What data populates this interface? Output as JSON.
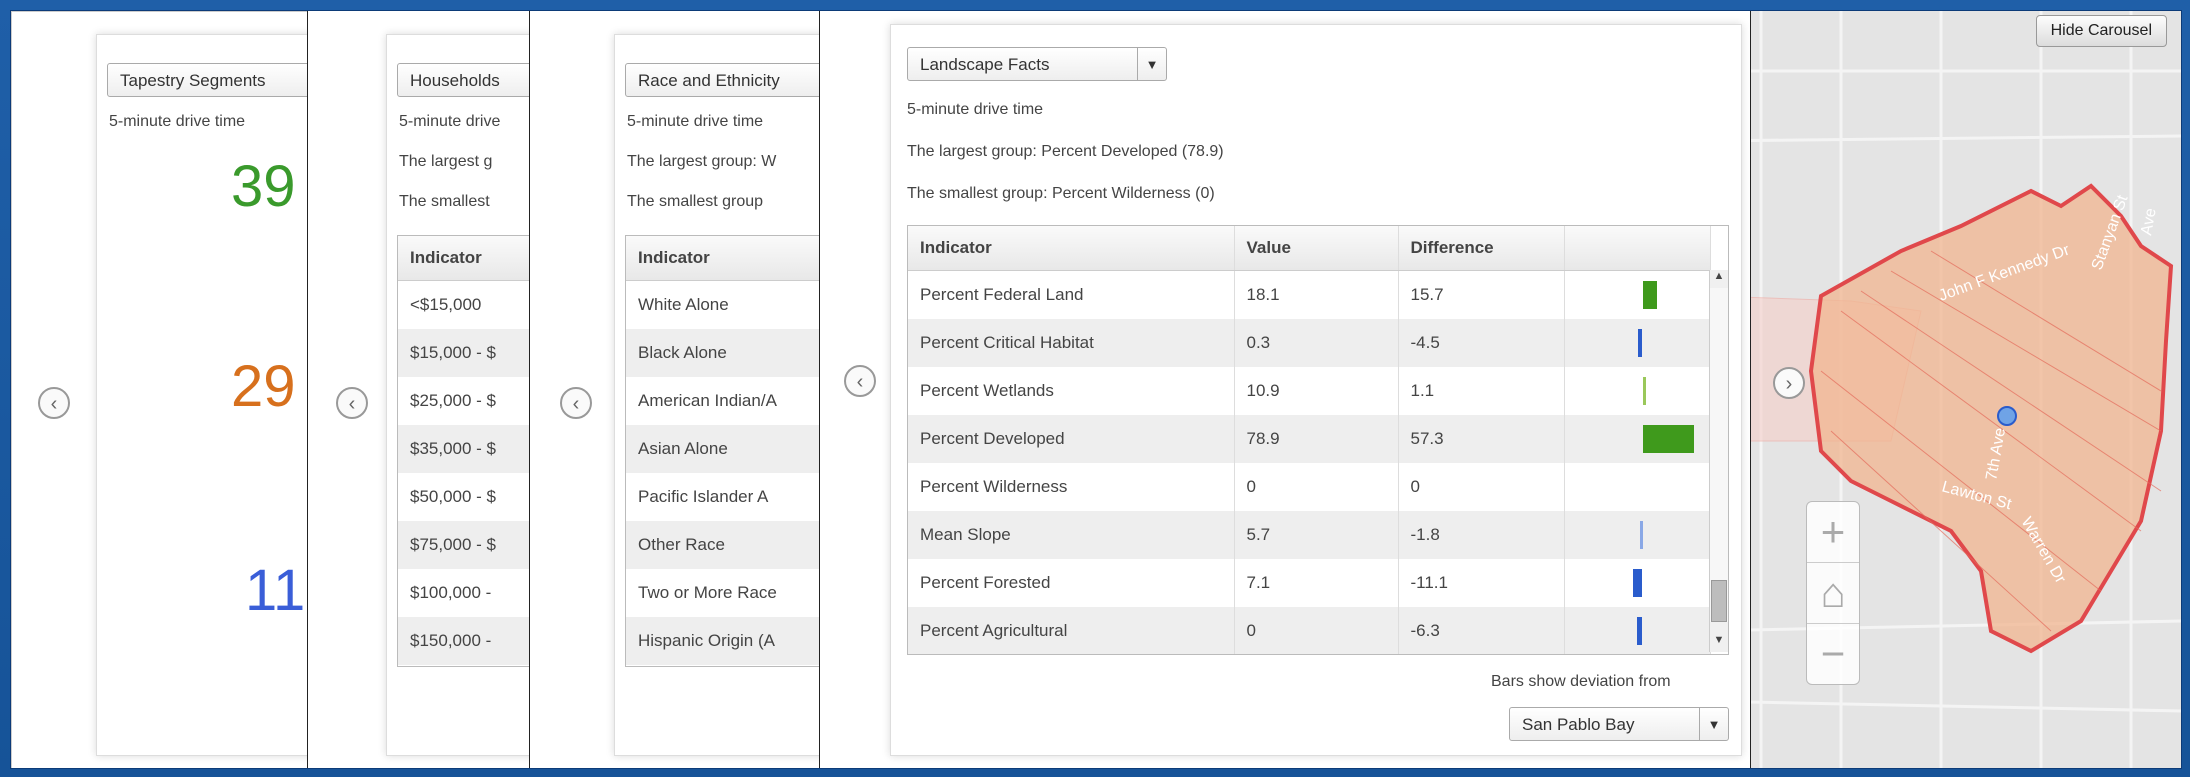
{
  "map": {
    "hide_carousel_label": "Hide Carousel",
    "street_labels": [
      "John F Kennedy Dr",
      "Stanyan St",
      "Lawton St",
      "7th Ave",
      "Warren Dr",
      "Ave"
    ]
  },
  "panel1": {
    "dropdown": "Tapestry Segments",
    "drive_time": "5-minute drive time",
    "numbers": [
      {
        "value": "39",
        "color": "#3a9a2c"
      },
      {
        "value": "29",
        "color": "#d7701d"
      },
      {
        "value": "11",
        "color": "#3a5ed8"
      }
    ]
  },
  "panel2": {
    "dropdown": "Households",
    "drive_time": "5-minute drive",
    "largest": "The largest g",
    "smallest": "The smallest",
    "header": "Indicator",
    "rows": [
      "<$15,000",
      "$15,000 - $",
      "$25,000 - $",
      "$35,000 - $",
      "$50,000 - $",
      "$75,000 - $",
      "$100,000 -",
      "$150,000 -"
    ]
  },
  "panel3": {
    "dropdown": "Race and Ethnicity",
    "drive_time": "5-minute drive time",
    "largest": "The largest group: W",
    "smallest": "The smallest group",
    "header": "Indicator",
    "rows": [
      "White Alone",
      "Black Alone",
      "American Indian/A",
      "Asian Alone",
      "Pacific Islander A",
      "Other Race",
      "Two or More Race",
      "Hispanic Origin (A"
    ]
  },
  "panel4": {
    "dropdown": "Landscape Facts",
    "drive_time": "5-minute drive time",
    "largest": "The largest group: Percent Developed (78.9)",
    "smallest": "The smallest group: Percent Wilderness (0)",
    "headers": [
      "Indicator",
      "Value",
      "Difference",
      ""
    ],
    "rows": [
      {
        "indicator": "Percent Federal Land",
        "value": "18.1",
        "difference": "15.7",
        "bar": 15.7,
        "color": "#3f9a1c"
      },
      {
        "indicator": "Percent Critical Habitat",
        "value": "0.3",
        "difference": "-4.5",
        "bar": -4.5,
        "color": "#2a5ccc"
      },
      {
        "indicator": "Percent Wetlands",
        "value": "10.9",
        "difference": "1.1",
        "bar": 1.1,
        "color": "#9ac85a"
      },
      {
        "indicator": "Percent Developed",
        "value": "78.9",
        "difference": "57.3",
        "bar": 57.3,
        "color": "#3f9a1c"
      },
      {
        "indicator": "Percent Wilderness",
        "value": "0",
        "difference": "0",
        "bar": 0,
        "color": "#3f9a1c"
      },
      {
        "indicator": "Mean Slope",
        "value": "5.7",
        "difference": "-1.8",
        "bar": -1.8,
        "color": "#8aa8e6"
      },
      {
        "indicator": "Percent Forested",
        "value": "7.1",
        "difference": "-11.1",
        "bar": -11.1,
        "color": "#2a5ccc"
      },
      {
        "indicator": "Percent Agricultural",
        "value": "0",
        "difference": "-6.3",
        "bar": -6.3,
        "color": "#2a5ccc"
      }
    ],
    "deviation_label": "Bars show deviation from",
    "deviation_select": "San Pablo Bay"
  }
}
